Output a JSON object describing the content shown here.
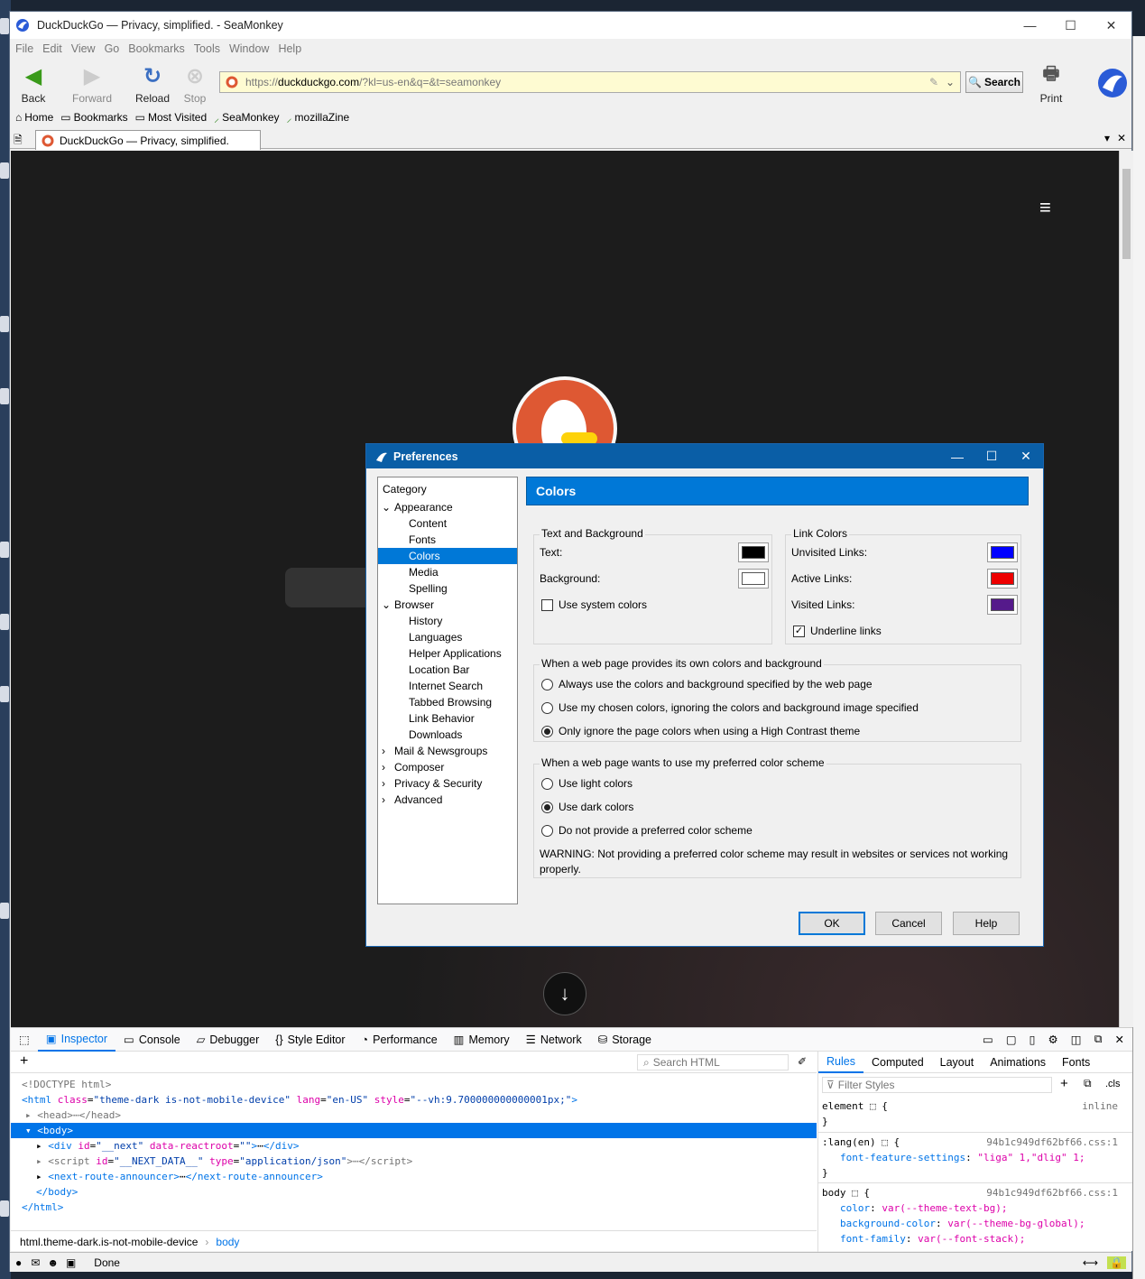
{
  "window": {
    "title": "DuckDuckGo — Privacy, simplified. - SeaMonkey",
    "minimize": "—",
    "maximize": "☐",
    "close": "✕"
  },
  "menu": [
    "File",
    "Edit",
    "View",
    "Go",
    "Bookmarks",
    "Tools",
    "Window",
    "Help"
  ],
  "nav": {
    "back": "Back",
    "forward": "Forward",
    "reload": "Reload",
    "stop": "Stop",
    "print": "Print",
    "search": "Search"
  },
  "url": {
    "host": "duckduckgo.com",
    "prefix": "https://",
    "rest": "/?kl=us-en&q=&t=seamonkey"
  },
  "bookmarks": [
    "Home",
    "Bookmarks",
    "Most Visited",
    "SeaMonkey",
    "mozillaZine"
  ],
  "tab": {
    "title": "DuckDuckGo — Privacy, simplified."
  },
  "dialog": {
    "title": "Preferences",
    "category_header": "Category",
    "panel_title": "Colors",
    "tree": [
      {
        "label": "Appearance",
        "level": 0,
        "arrow": "⌄"
      },
      {
        "label": "Content",
        "level": 1
      },
      {
        "label": "Fonts",
        "level": 1
      },
      {
        "label": "Colors",
        "level": 1,
        "selected": true
      },
      {
        "label": "Media",
        "level": 1
      },
      {
        "label": "Spelling",
        "level": 1
      },
      {
        "label": "Browser",
        "level": 0,
        "arrow": "⌄"
      },
      {
        "label": "History",
        "level": 1
      },
      {
        "label": "Languages",
        "level": 1
      },
      {
        "label": "Helper Applications",
        "level": 1
      },
      {
        "label": "Location Bar",
        "level": 1
      },
      {
        "label": "Internet Search",
        "level": 1
      },
      {
        "label": "Tabbed Browsing",
        "level": 1
      },
      {
        "label": "Link Behavior",
        "level": 1
      },
      {
        "label": "Downloads",
        "level": 1
      },
      {
        "label": "Mail & Newsgroups",
        "level": 0,
        "arrow": "›"
      },
      {
        "label": "Composer",
        "level": 0,
        "arrow": "›"
      },
      {
        "label": "Privacy & Security",
        "level": 0,
        "arrow": "›"
      },
      {
        "label": "Advanced",
        "level": 0,
        "arrow": "›"
      }
    ],
    "text_bg": {
      "legend": "Text and Background",
      "text": "Text:",
      "background": "Background:",
      "system": "Use system colors",
      "text_color": "#000000",
      "bg_color": "#ffffff"
    },
    "links": {
      "legend": "Link Colors",
      "unvisited": "Unvisited Links:",
      "active": "Active Links:",
      "visited": "Visited Links:",
      "underline": "Underline links",
      "unvisited_color": "#0000ff",
      "active_color": "#ee0000",
      "visited_color": "#551a8b"
    },
    "own_colors": {
      "legend": "When a web page provides its own colors and background",
      "opt1": "Always use the colors and background specified by the web page",
      "opt2": "Use my chosen colors, ignoring the colors and background image specified",
      "opt3": "Only ignore the page colors when using a High Contrast theme"
    },
    "scheme": {
      "legend": "When a web page wants to use my preferred color scheme",
      "opt1": "Use light colors",
      "opt2": "Use dark colors",
      "opt3": "Do not provide a preferred color scheme",
      "warning": "WARNING: Not providing a preferred color scheme may result in websites or services not working properly."
    },
    "ok": "OK",
    "cancel": "Cancel",
    "help": "Help"
  },
  "devtools": {
    "tabs": [
      "Inspector",
      "Console",
      "Debugger",
      "Style Editor",
      "Performance",
      "Memory",
      "Network",
      "Storage"
    ],
    "search_placeholder": "Search HTML",
    "right_tabs": [
      "Rules",
      "Computed",
      "Layout",
      "Animations",
      "Fonts"
    ],
    "filter_placeholder": "Filter Styles",
    "cls": ".cls",
    "crumbs": [
      "html.theme-dark.is-not-mobile-device",
      "body"
    ],
    "rules": {
      "element": "element",
      "inline": "inline",
      "lang_sel": ":lang(en)",
      "src1": "94b1c949df62bf66.css:1",
      "lang_prop": "font-feature-settings",
      "lang_val": "\"liga\" 1,\"dlig\" 1;",
      "body_sel": "body",
      "src2": "94b1c949df62bf66.css:1",
      "p1": "color",
      "v1": "var(--theme-text-bg);",
      "p2": "background-color",
      "v2": "var(--theme-bg-global);",
      "p3": "font-family",
      "v3": "var(--font-stack);"
    }
  },
  "status": {
    "text": "Done"
  },
  "colors": {
    "dialog_title": "#0a5ea6",
    "selection": "#0078d7",
    "devtools_accent": "#0074e8"
  }
}
